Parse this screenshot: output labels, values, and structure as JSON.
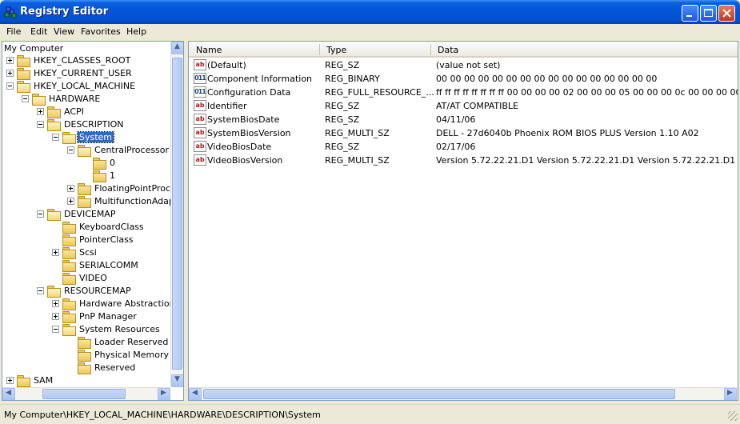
{
  "window": {
    "title": "Registry Editor"
  },
  "menu": [
    "File",
    "Edit",
    "View",
    "Favorites",
    "Help"
  ],
  "tree": {
    "root": "My Computer",
    "items": [
      {
        "label": "HKEY_CLASSES_ROOT",
        "depth": 0,
        "state": "collapsed"
      },
      {
        "label": "HKEY_CURRENT_USER",
        "depth": 0,
        "state": "collapsed"
      },
      {
        "label": "HKEY_LOCAL_MACHINE",
        "depth": 0,
        "state": "expanded"
      },
      {
        "label": "HARDWARE",
        "depth": 1,
        "state": "expanded"
      },
      {
        "label": "ACPI",
        "depth": 2,
        "state": "collapsed"
      },
      {
        "label": "DESCRIPTION",
        "depth": 2,
        "state": "expanded"
      },
      {
        "label": "System",
        "depth": 3,
        "state": "expanded",
        "selected": true
      },
      {
        "label": "CentralProcessor",
        "depth": 4,
        "state": "expanded"
      },
      {
        "label": "0",
        "depth": 5,
        "state": "leaf"
      },
      {
        "label": "1",
        "depth": 5,
        "state": "leaf"
      },
      {
        "label": "FloatingPointProcessor",
        "depth": 4,
        "state": "collapsed"
      },
      {
        "label": "MultifunctionAdapter",
        "depth": 4,
        "state": "collapsed"
      },
      {
        "label": "DEVICEMAP",
        "depth": 2,
        "state": "expanded"
      },
      {
        "label": "KeyboardClass",
        "depth": 3,
        "state": "leaf"
      },
      {
        "label": "PointerClass",
        "depth": 3,
        "state": "leaf"
      },
      {
        "label": "Scsi",
        "depth": 3,
        "state": "collapsed"
      },
      {
        "label": "SERIALCOMM",
        "depth": 3,
        "state": "leaf"
      },
      {
        "label": "VIDEO",
        "depth": 3,
        "state": "leaf"
      },
      {
        "label": "RESOURCEMAP",
        "depth": 2,
        "state": "expanded"
      },
      {
        "label": "Hardware Abstraction Layer",
        "depth": 3,
        "state": "collapsed"
      },
      {
        "label": "PnP Manager",
        "depth": 3,
        "state": "collapsed"
      },
      {
        "label": "System Resources",
        "depth": 3,
        "state": "expanded"
      },
      {
        "label": "Loader Reserved",
        "depth": 4,
        "state": "leaf"
      },
      {
        "label": "Physical Memory",
        "depth": 4,
        "state": "leaf"
      },
      {
        "label": "Reserved",
        "depth": 4,
        "state": "leaf"
      },
      {
        "label": "SAM",
        "depth": 0,
        "state": "collapsed"
      }
    ]
  },
  "list": {
    "columns": [
      "Name",
      "Type",
      "Data"
    ],
    "rows": [
      {
        "icon": "string-value-icon",
        "name": "(Default)",
        "type": "REG_SZ",
        "data": "(value not set)"
      },
      {
        "icon": "binary-value-icon",
        "name": "Component Information",
        "type": "REG_BINARY",
        "data": "00 00 00 00 00 00 00 00 00 00 00 00 00 00 00 00"
      },
      {
        "icon": "binary-value-icon",
        "name": "Configuration Data",
        "type": "REG_FULL_RESOURCE_...",
        "data": "ff ff ff ff ff ff ff ff 00 00 00 00 02 00 00 00 05 00 00 00 0c 00 00 00 00 00 00 0"
      },
      {
        "icon": "string-value-icon",
        "name": "Identifier",
        "type": "REG_SZ",
        "data": "AT/AT COMPATIBLE"
      },
      {
        "icon": "string-value-icon",
        "name": "SystemBiosDate",
        "type": "REG_SZ",
        "data": "04/11/06"
      },
      {
        "icon": "string-value-icon",
        "name": "SystemBiosVersion",
        "type": "REG_MULTI_SZ",
        "data": "DELL   - 27d6040b Phoenix ROM BIOS PLUS Version 1.10 A02"
      },
      {
        "icon": "string-value-icon",
        "name": "VideoBiosDate",
        "type": "REG_SZ",
        "data": "02/17/06"
      },
      {
        "icon": "string-value-icon",
        "name": "VideoBiosVersion",
        "type": "REG_MULTI_SZ",
        "data": "Version  5.72.22.21.D1  Version  5.72.22.21.D1  Version  5.72.22.21.D1"
      }
    ]
  },
  "status": {
    "path": "My Computer\\HKEY_LOCAL_MACHINE\\HARDWARE\\DESCRIPTION\\System"
  },
  "colors": {
    "title_bar": "#0354d8",
    "selection": "#316ac5",
    "window_bg": "#ece9d8"
  }
}
